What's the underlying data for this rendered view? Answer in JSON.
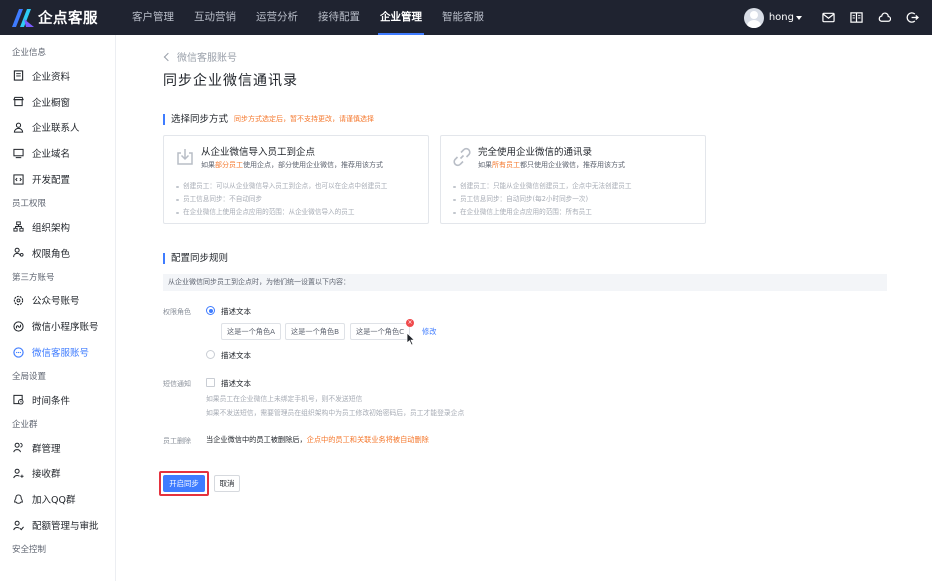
{
  "app": {
    "name": "企点客服"
  },
  "nav": {
    "items": [
      "客户管理",
      "互动营销",
      "运营分析",
      "接待配置",
      "企业管理",
      "智能客服"
    ],
    "active_index": 4
  },
  "user": {
    "name": "hong"
  },
  "sidebar": {
    "groups": [
      {
        "title": "企业信息",
        "items": [
          "企业资料",
          "企业橱窗",
          "企业联系人",
          "企业域名",
          "开发配置"
        ]
      },
      {
        "title": "员工权限",
        "items": [
          "组织架构",
          "权限角色"
        ]
      },
      {
        "title": "第三方账号",
        "items": [
          "公众号账号",
          "微信小程序账号",
          "微信客服账号"
        ]
      },
      {
        "title": "全局设置",
        "items": [
          "时间条件"
        ]
      },
      {
        "title": "企业群",
        "items": [
          "群管理",
          "接收群",
          "加入QQ群",
          "配额管理与审批"
        ]
      },
      {
        "title": "安全控制",
        "items": []
      }
    ],
    "active_item": "微信客服账号"
  },
  "main": {
    "breadcrumb": "微信客服账号",
    "title": "同步企业微信通讯录",
    "sync_method": {
      "title": "选择同步方式",
      "hint": "同步方式选定后，暂不支持更改，请谨慎选择",
      "cards": [
        {
          "title": "从企业微信导入员工到企点",
          "desc_prefix": "如果",
          "desc_highlight": "部分员工",
          "desc_suffix": "使用企点，部分使用企业微信，推荐用该方式",
          "bullets": [
            "创建员工：可以从企业微信导入员工到企点，也可以在企点中创建员工",
            "员工信息同步：不自动同步",
            "在企业微信上使用企点应用的范围：从企业微信导入的员工"
          ]
        },
        {
          "title": "完全使用企业微信的通讯录",
          "desc_prefix": "如果",
          "desc_highlight": "所有员工",
          "desc_suffix": "都只使用企业微信，推荐用该方式",
          "bullets": [
            "创建员工：只能从企业微信创建员工，企点中无法创建员工",
            "员工信息同步：自动同步(每2小时同步一次)",
            "在企业微信上使用企点应用的范围：所有员工"
          ]
        }
      ]
    },
    "rules": {
      "title": "配置同步规则",
      "info": "从企业微信同步员工到企点时，为他们统一设置以下内容：",
      "permission_label": "权限角色",
      "option1": "描述文本",
      "tags": [
        "这是一个角色A",
        "这是一个角色B",
        "这是一个角色C"
      ],
      "edit": "修改",
      "option2": "描述文本",
      "sms_label": "短信通知",
      "sms_option": "描述文本",
      "sms_note1": "如果员工在企业微信上未绑定手机号，则不发送短信",
      "sms_note2": "如果不发送短信，需要管理员在组织架构中为员工修改初始密码后，员工才能登录企点",
      "delete_label": "员工删除",
      "delete_prefix": "当企业微信中的员工被删除后，",
      "delete_highlight": "企点中的员工和关联业务将被自动删除"
    },
    "buttons": {
      "confirm": "开启同步",
      "cancel": "取消"
    }
  }
}
